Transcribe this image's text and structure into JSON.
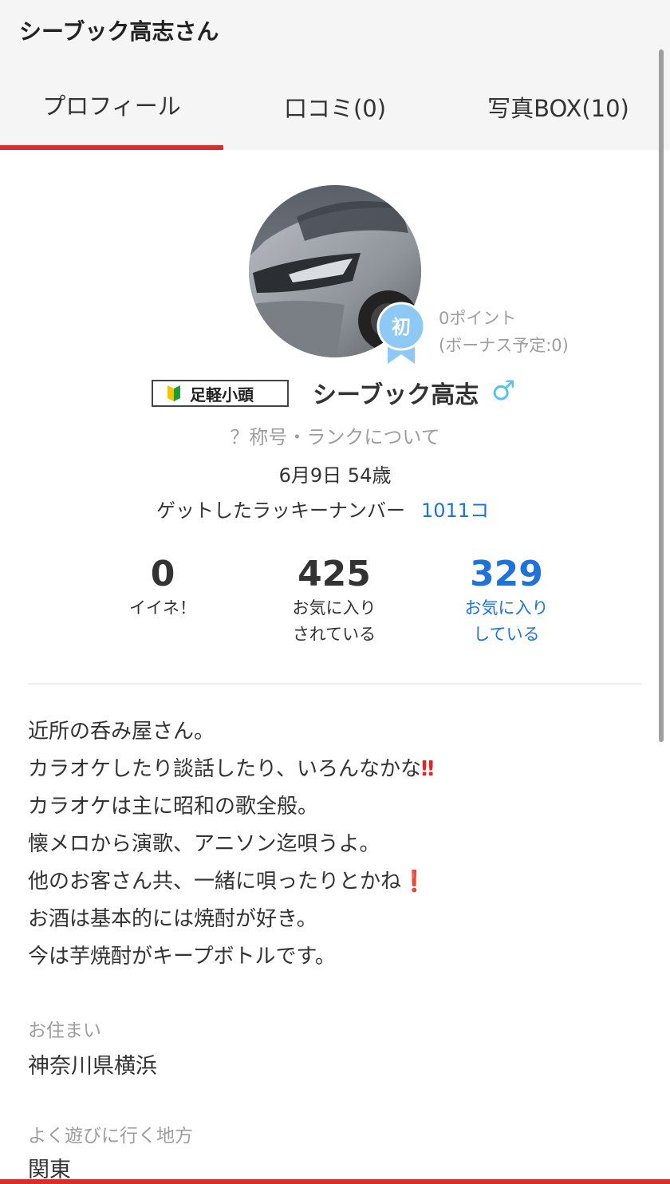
{
  "header": {
    "title": "シーブック高志さん"
  },
  "tabs": [
    {
      "label": "プロフィール",
      "active": true
    },
    {
      "label": "口コミ(0)",
      "active": false
    },
    {
      "label": "写真BOX(10)",
      "active": false
    }
  ],
  "profile": {
    "badge_label": "初",
    "points": "0ポイント",
    "bonus": "(ボーナス予定:0)",
    "rank_title": "足軽小頭",
    "name": "シーブック高志",
    "gender_symbol": "♂",
    "rank_link": "？称号・ランクについて",
    "birthday": "6月9日 54歳",
    "lucky_label": "ゲットしたラッキーナンバー",
    "lucky_value": "1011コ"
  },
  "stats": [
    {
      "value": "0",
      "label1": "イイネ！",
      "label2": ""
    },
    {
      "value": "425",
      "label1": "お気に入り",
      "label2": "されている"
    },
    {
      "value": "329",
      "label1": "お気に入り",
      "label2": "している"
    }
  ],
  "bio": {
    "lines": [
      "近所の呑み屋さん。",
      "カラオケしたり談話したり、いろんなかな",
      "カラオケは主に昭和の歌全般。",
      "懐メロから演歌、アニソン迄唄うよ。",
      "他のお客さん共、一緒に唄ったりとかね",
      "お酒は基本的には焼酎が好き。",
      "今は芋焼酎がキープボトルです。"
    ],
    "emoji_double": "‼",
    "emoji_single": "❗"
  },
  "details": {
    "residence_label": "お住まい",
    "residence_value": "神奈川県横浜",
    "area_label": "よく遊びに行く地方",
    "area_value": "関東"
  },
  "colors": {
    "accent_red": "#d32f2f",
    "link_blue": "#1e73d8",
    "gender_blue": "#5bc0eb",
    "badge_blue": "#8ec8f5"
  }
}
